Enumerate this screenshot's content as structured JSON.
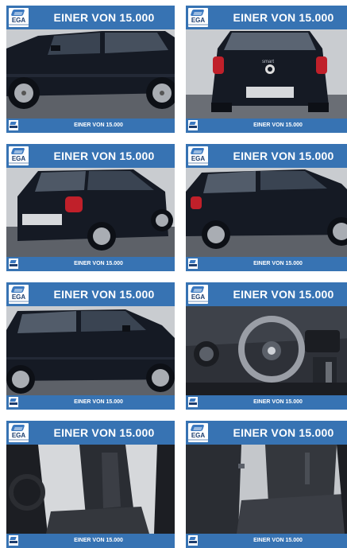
{
  "tiles": [
    {
      "banner": "EINER VON 15.000",
      "footer": "EINER VON 15.000",
      "logo": "EGA",
      "photo": "car-side-right"
    },
    {
      "banner": "EINER VON 15.000",
      "footer": "EINER VON 15.000",
      "logo": "EGA",
      "photo": "car-rear",
      "rear_badge": "smart"
    },
    {
      "banner": "EINER VON 15.000",
      "footer": "EINER VON 15.000",
      "logo": "EGA",
      "photo": "car-rear-quarter"
    },
    {
      "banner": "EINER VON 15.000",
      "footer": "EINER VON 15.000",
      "logo": "EGA",
      "photo": "car-side-left"
    },
    {
      "banner": "EINER VON 15.000",
      "footer": "EINER VON 15.000",
      "logo": "EGA",
      "photo": "car-side-left-2"
    },
    {
      "banner": "EINER VON 15.000",
      "footer": "EINER VON 15.000",
      "logo": "EGA",
      "photo": "interior-dashboard"
    },
    {
      "banner": "EINER VON 15.000",
      "footer": "EINER VON 15.000",
      "logo": "EGA",
      "photo": "interior-front-seats"
    },
    {
      "banner": "EINER VON 15.000",
      "footer": "EINER VON 15.000",
      "logo": "EGA",
      "photo": "interior-rear-seats"
    }
  ],
  "colors": {
    "banner": "#3773b3",
    "car_body": "#151a24",
    "ground": "#5d6168"
  }
}
